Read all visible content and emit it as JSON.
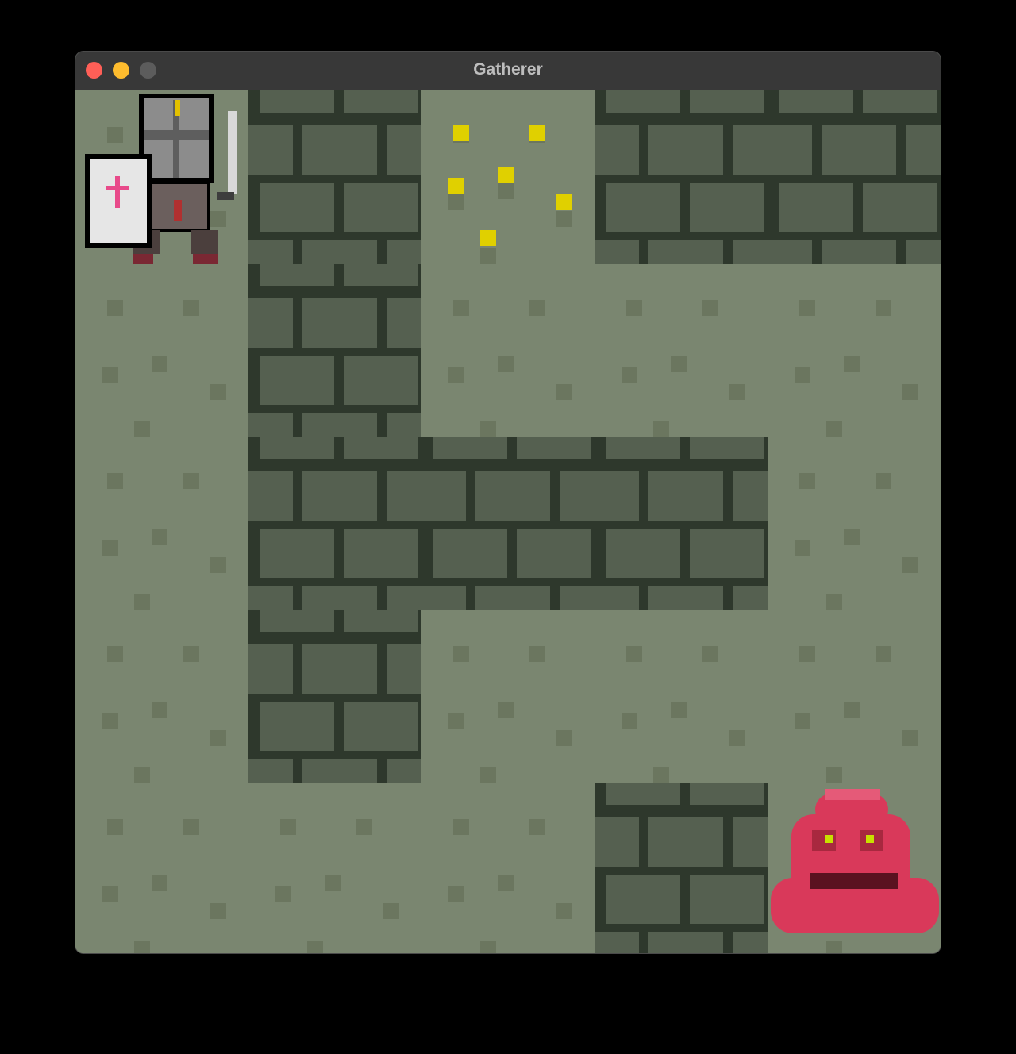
{
  "window": {
    "title": "Gatherer"
  },
  "grid": {
    "cols": 5,
    "rows": 5,
    "layout": [
      [
        "floor",
        "wall",
        "floor",
        "wall",
        "wall"
      ],
      [
        "floor",
        "wall",
        "floor",
        "floor",
        "floor"
      ],
      [
        "floor",
        "wall",
        "wall",
        "wall",
        "floor"
      ],
      [
        "floor",
        "wall",
        "floor",
        "floor",
        "floor"
      ],
      [
        "floor",
        "floor",
        "floor",
        "wall",
        "floor"
      ]
    ]
  },
  "entities": {
    "player": {
      "name": "knight",
      "row": 0,
      "col": 0
    },
    "enemy": {
      "name": "red-slime",
      "row": 4,
      "col": 4
    },
    "gold": {
      "row": 0,
      "col": 2,
      "count": 6
    }
  },
  "colors": {
    "floor": "#7a8670",
    "floor_speck": "#6b765f",
    "wall_mortar": "#2e382c",
    "wall_brick": "#556050",
    "gold": "#e0d000",
    "slime": "#d9395a"
  }
}
